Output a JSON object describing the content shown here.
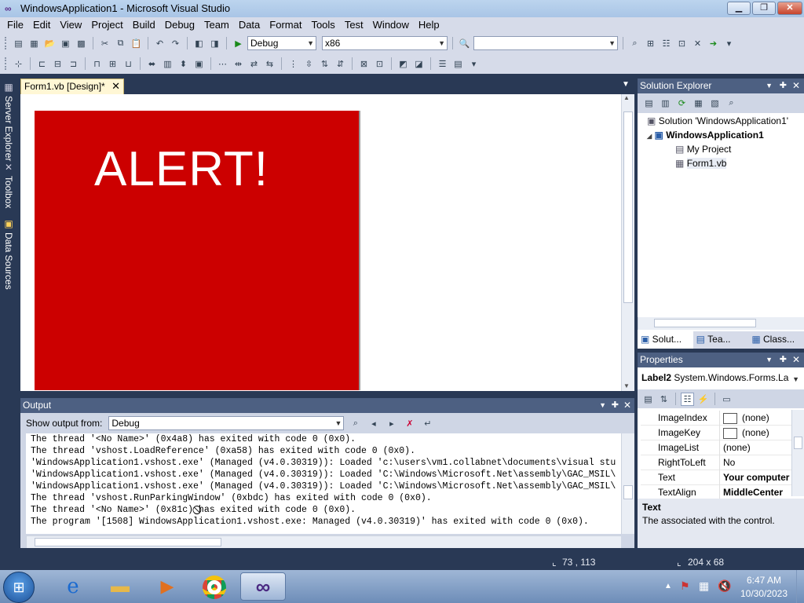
{
  "window": {
    "title": "WindowsApplication1 - Microsoft Visual Studio",
    "min": "▁",
    "max": "❐",
    "close": "✕"
  },
  "menu": [
    "File",
    "Edit",
    "View",
    "Project",
    "Build",
    "Debug",
    "Team",
    "Data",
    "Format",
    "Tools",
    "Test",
    "Window",
    "Help"
  ],
  "toolbar": {
    "config": "Debug",
    "platform": "x86",
    "find": ""
  },
  "sidebar": {
    "server_explorer": "Server Explorer",
    "toolbox": "Toolbox",
    "data_sources": "Data Sources"
  },
  "doc": {
    "tab": "Form1.vb [Design]*",
    "close": "✕",
    "alert_text": "ALERT!"
  },
  "solution_explorer": {
    "title": "Solution Explorer",
    "solution": "Solution 'WindowsApplication1'",
    "project": "WindowsApplication1",
    "items": [
      "My Project",
      "Form1.vb"
    ],
    "tabs": [
      "Solut...",
      "Tea...",
      "Class..."
    ]
  },
  "properties": {
    "title": "Properties",
    "object": "Label2",
    "type": "System.Windows.Forms.La",
    "rows": [
      {
        "name": "ImageIndex",
        "value": "(none)"
      },
      {
        "name": "ImageKey",
        "value": "(none)"
      },
      {
        "name": "ImageList",
        "value": "(none)"
      },
      {
        "name": "RightToLeft",
        "value": "No"
      },
      {
        "name": "Text",
        "value": "Your computer"
      },
      {
        "name": "TextAlign",
        "value": "MiddleCenter"
      }
    ],
    "desc_title": "Text",
    "desc": "The associated with the control."
  },
  "output": {
    "title": "Output",
    "show_from_label": "Show output from:",
    "show_from_value": "Debug",
    "lines": [
      "The thread '<No Name>' (0x4a8) has exited with code 0 (0x0).",
      "The thread 'vshost.LoadReference' (0xa58) has exited with code 0 (0x0).",
      "'WindowsApplication1.vshost.exe' (Managed (v4.0.30319)): Loaded 'c:\\users\\vm1.collabnet\\documents\\visual stu",
      "'WindowsApplication1.vshost.exe' (Managed (v4.0.30319)): Loaded 'C:\\Windows\\Microsoft.Net\\assembly\\GAC_MSIL\\",
      "'WindowsApplication1.vshost.exe' (Managed (v4.0.30319)): Loaded 'C:\\Windows\\Microsoft.Net\\assembly\\GAC_MSIL\\",
      "The thread 'vshost.RunParkingWindow' (0xbdc) has exited with code 0 (0x0).",
      "The thread '<No Name>' (0x81c) has exited with code 0 (0x0).",
      "The program '[1508] WindowsApplication1.vshost.exe: Managed (v4.0.30319)' has exited with code 0 (0x0)."
    ]
  },
  "status": {
    "position": "73 , 113",
    "size": "204 x 68"
  },
  "taskbar": {
    "time": "6:47 AM",
    "date": "10/30/2023"
  }
}
